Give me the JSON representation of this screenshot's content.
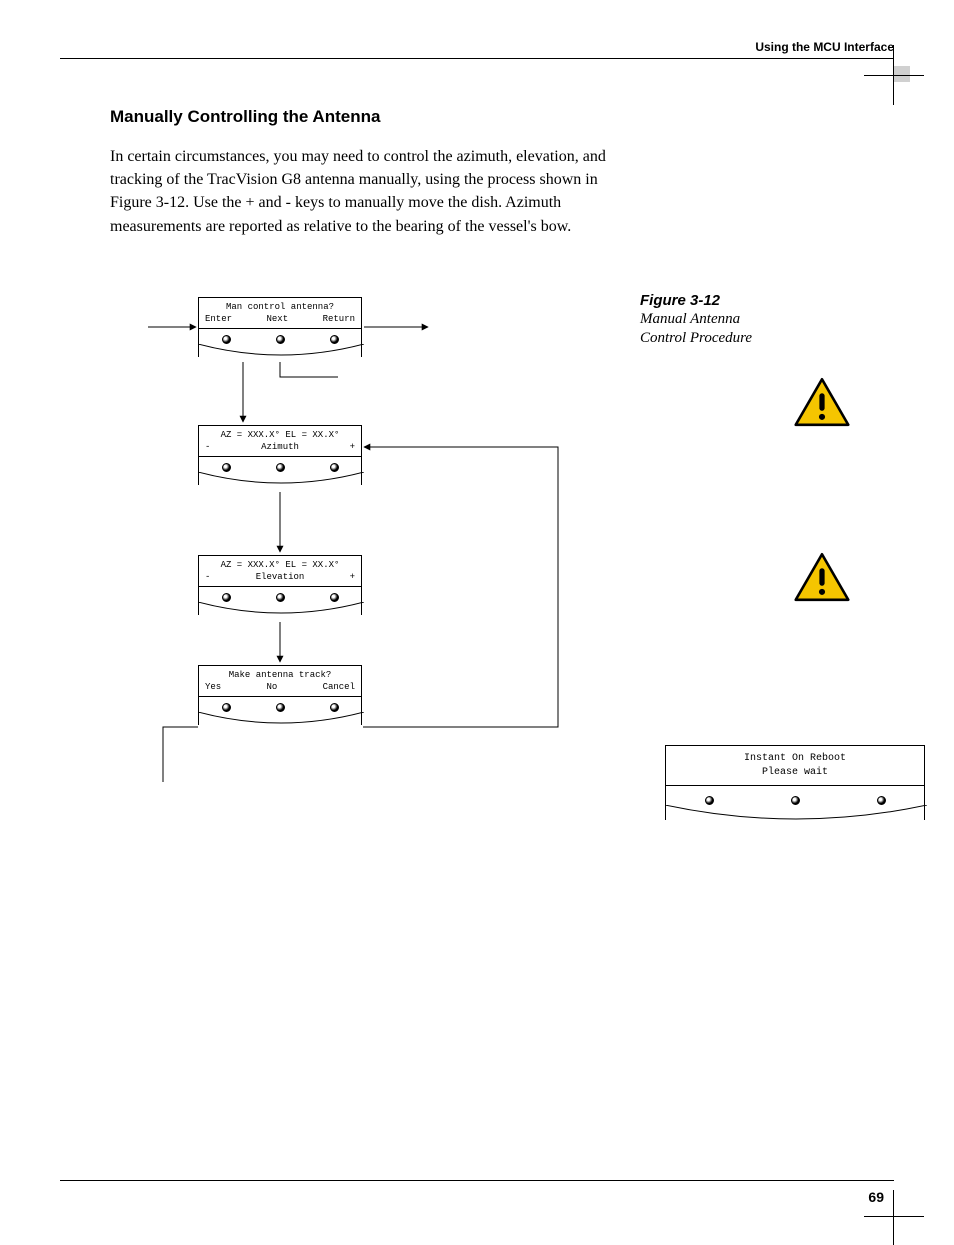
{
  "header": {
    "running": "Using the MCU Interface"
  },
  "section": {
    "title": "Manually Controlling the Antenna"
  },
  "body": {
    "p1": "In certain circumstances, you may need to control the azimuth, elevation, and tracking of the TracVision G8 antenna manually, using the process shown in Figure 3-12. Use the + and - keys to manually move the dish. Azimuth measurements are reported as relative to the bearing of the vessel's bow."
  },
  "figure": {
    "number": "Figure 3-12",
    "caption_l1": "Manual Antenna",
    "caption_l2": "Control Procedure"
  },
  "mcu_screens": {
    "s1": {
      "line1": "Man control antenna?",
      "b1": "Enter",
      "b2": "Next",
      "b3": "Return"
    },
    "s2": {
      "line1": "AZ = XXX.X°  EL = XX.X°",
      "b1": "-",
      "b2": "Azimuth",
      "b3": "+"
    },
    "s3": {
      "line1": "AZ = XXX.X°  EL = XX.X°",
      "b1": "-",
      "b2": "Elevation",
      "b3": "+"
    },
    "s4": {
      "line1": "Make antenna track?",
      "b1": "Yes",
      "b2": "No",
      "b3": "Cancel"
    },
    "reboot": {
      "line1": "Instant On Reboot",
      "line2": "Please wait"
    }
  },
  "page_number": "69"
}
